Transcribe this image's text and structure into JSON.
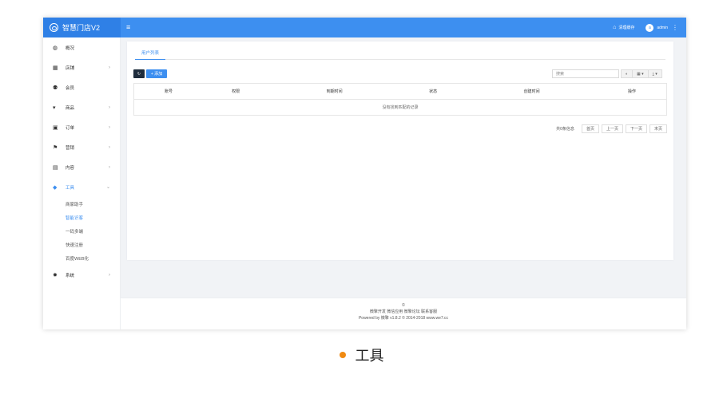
{
  "header": {
    "brand": "智慧门店V2",
    "clear_cache": "清理缓存",
    "user": "admin",
    "avatar_letter": "a"
  },
  "sidebar": {
    "items": [
      {
        "label": "概况",
        "icon": "dashboard-icon",
        "glyph": "◍",
        "arrow": ""
      },
      {
        "label": "店铺",
        "icon": "grid-icon",
        "glyph": "▦",
        "arrow": "›"
      },
      {
        "label": "会员",
        "icon": "users-icon",
        "glyph": "⚉",
        "arrow": ""
      },
      {
        "label": "商品",
        "icon": "cart-icon",
        "glyph": "▾",
        "arrow": "›"
      },
      {
        "label": "订单",
        "icon": "order-icon",
        "glyph": "▣",
        "arrow": "›"
      },
      {
        "label": "营销",
        "icon": "flag-icon",
        "glyph": "⚑",
        "arrow": "›"
      },
      {
        "label": "内容",
        "icon": "file-icon",
        "glyph": "▤",
        "arrow": "›"
      },
      {
        "label": "工具",
        "icon": "cube-icon",
        "glyph": "◆",
        "arrow": "⌄",
        "active": true
      },
      {
        "label": "系统",
        "icon": "gear-icon",
        "glyph": "✹",
        "arrow": "›"
      }
    ],
    "tool_subitems": [
      {
        "label": "商家助手"
      },
      {
        "label": "智能识客",
        "active": true
      },
      {
        "label": "一码多端"
      },
      {
        "label": "快速注册"
      },
      {
        "label": "百度WEB化"
      }
    ]
  },
  "content": {
    "tab_label": "用户列表",
    "add_label": "+ 添加",
    "search_placeholder": "搜索",
    "columns": [
      "账号",
      "权限",
      "到期时间",
      "状态",
      "创建时间",
      "操作"
    ],
    "empty_text": "没有找到匹配的记录",
    "pagination": {
      "total": "共0条信息",
      "first": "首页",
      "prev": "上一页",
      "next": "下一页",
      "last": "末页"
    }
  },
  "footer": {
    "copyright_symbol": "©",
    "links": "微擎开发 微信应用 微擎论坛 联系客服",
    "powered": "Powered by 微擎 v1.8.2 © 2014-2018 www.we7.cc"
  },
  "caption": "工具",
  "colors": {
    "accent": "#3d8ff0",
    "caption_dot": "#f08a12"
  }
}
